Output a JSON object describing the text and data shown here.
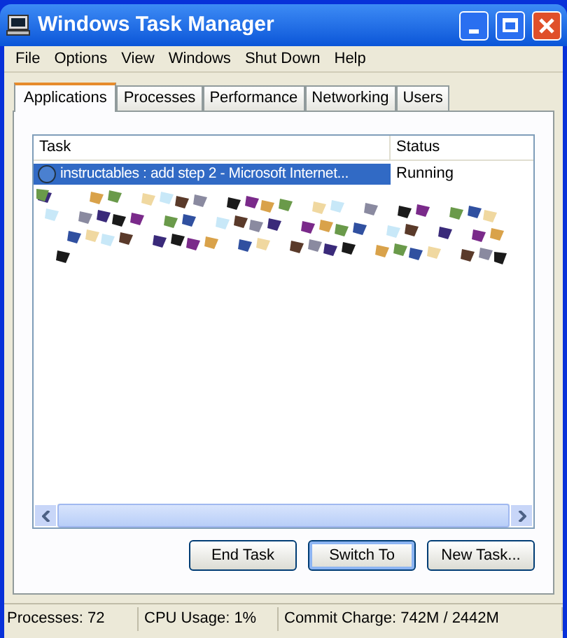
{
  "window": {
    "title": "Windows Task Manager"
  },
  "menu": [
    "File",
    "Options",
    "View",
    "Windows",
    "Shut Down",
    "Help"
  ],
  "tabs": [
    {
      "label": "Applications",
      "selected": true
    },
    {
      "label": "Processes",
      "selected": false
    },
    {
      "label": "Performance",
      "selected": false
    },
    {
      "label": "Networking",
      "selected": false
    },
    {
      "label": "Users",
      "selected": false
    }
  ],
  "table": {
    "columns": [
      "Task",
      "Status"
    ],
    "rows": [
      {
        "task": "instructables : add step 2 - Microsoft Internet...",
        "status": "Running",
        "selected": true
      }
    ],
    "redacted": {
      "kind": "picture"
    }
  },
  "buttons": [
    "End Task",
    "Switch To",
    "New Task..."
  ],
  "status_bar": [
    "Processes: 72",
    "CPU Usage: 1%",
    "Commit Charge: 742M / 2442M"
  ]
}
